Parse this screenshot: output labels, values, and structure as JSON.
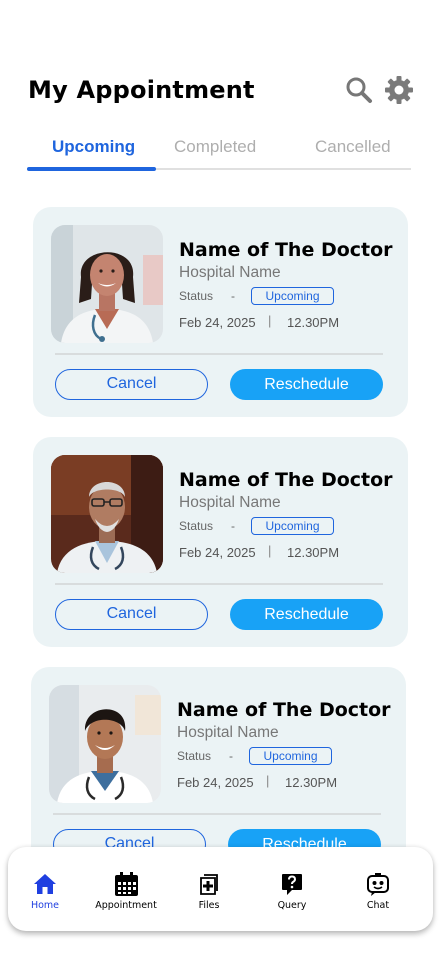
{
  "header": {
    "title": "My Appointment",
    "search_icon": "search-icon",
    "settings_icon": "gear-icon"
  },
  "tabs": [
    {
      "label": "Upcoming",
      "active": true
    },
    {
      "label": "Completed",
      "active": false
    },
    {
      "label": "Cancelled",
      "active": false
    }
  ],
  "appointments": [
    {
      "doctor_name": "Name of The Doctor",
      "hospital": "Hospital Name",
      "status_label": "Status",
      "status_sep": "-",
      "status": "Upcoming",
      "date": "Feb 24, 2025",
      "separator": "|",
      "time": "12.30PM",
      "cancel_label": "Cancel",
      "reschedule_label": "Reschedule"
    },
    {
      "doctor_name": "Name of The Doctor",
      "hospital": "Hospital Name",
      "status_label": "Status",
      "status_sep": "-",
      "status": "Upcoming",
      "date": "Feb 24, 2025",
      "separator": "|",
      "time": "12.30PM",
      "cancel_label": "Cancel",
      "reschedule_label": "Reschedule"
    },
    {
      "doctor_name": "Name of The Doctor",
      "hospital": "Hospital Name",
      "status_label": "Status",
      "status_sep": "-",
      "status": "Upcoming",
      "date": "Feb 24, 2025",
      "separator": "|",
      "time": "12.30PM",
      "cancel_label": "Cancel",
      "reschedule_label": "Reschedule"
    }
  ],
  "bottom_nav": [
    {
      "label": "Home",
      "icon": "home-icon",
      "active": true
    },
    {
      "label": "Appointment",
      "icon": "calendar-icon",
      "active": false
    },
    {
      "label": "Files",
      "icon": "medical-file-icon",
      "active": false
    },
    {
      "label": "Query",
      "icon": "question-icon",
      "active": false
    },
    {
      "label": "Chat",
      "icon": "chatbot-icon",
      "active": false
    }
  ],
  "colors": {
    "accent": "#1f65de",
    "reschedule": "#18a2f6",
    "card_bg": "#ebf3f5",
    "home_active": "#1f3fe0"
  }
}
